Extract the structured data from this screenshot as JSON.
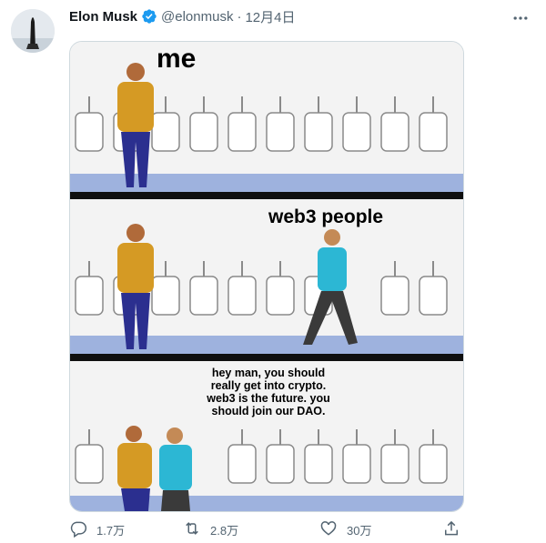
{
  "author": {
    "name": "Elon Musk",
    "handle": "@elonmusk",
    "separator": "·",
    "date": "12月4日"
  },
  "icons": {
    "verified": "verified-badge-icon",
    "more": "more-horizontal-icon",
    "reply": "reply-icon",
    "retweet": "retweet-icon",
    "like": "heart-icon",
    "share": "share-icon"
  },
  "colors": {
    "verified": "#1d9bf0",
    "muted": "#536471",
    "border": "#cfd9de"
  },
  "meme": {
    "label_me": "me",
    "label_web3": "web3 people",
    "speech": "hey man, you should really get into crypto. web3 is the future. you should join our DAO."
  },
  "actions": {
    "reply_count": "1.7万",
    "retweet_count": "2.8万",
    "like_count": "30万"
  }
}
